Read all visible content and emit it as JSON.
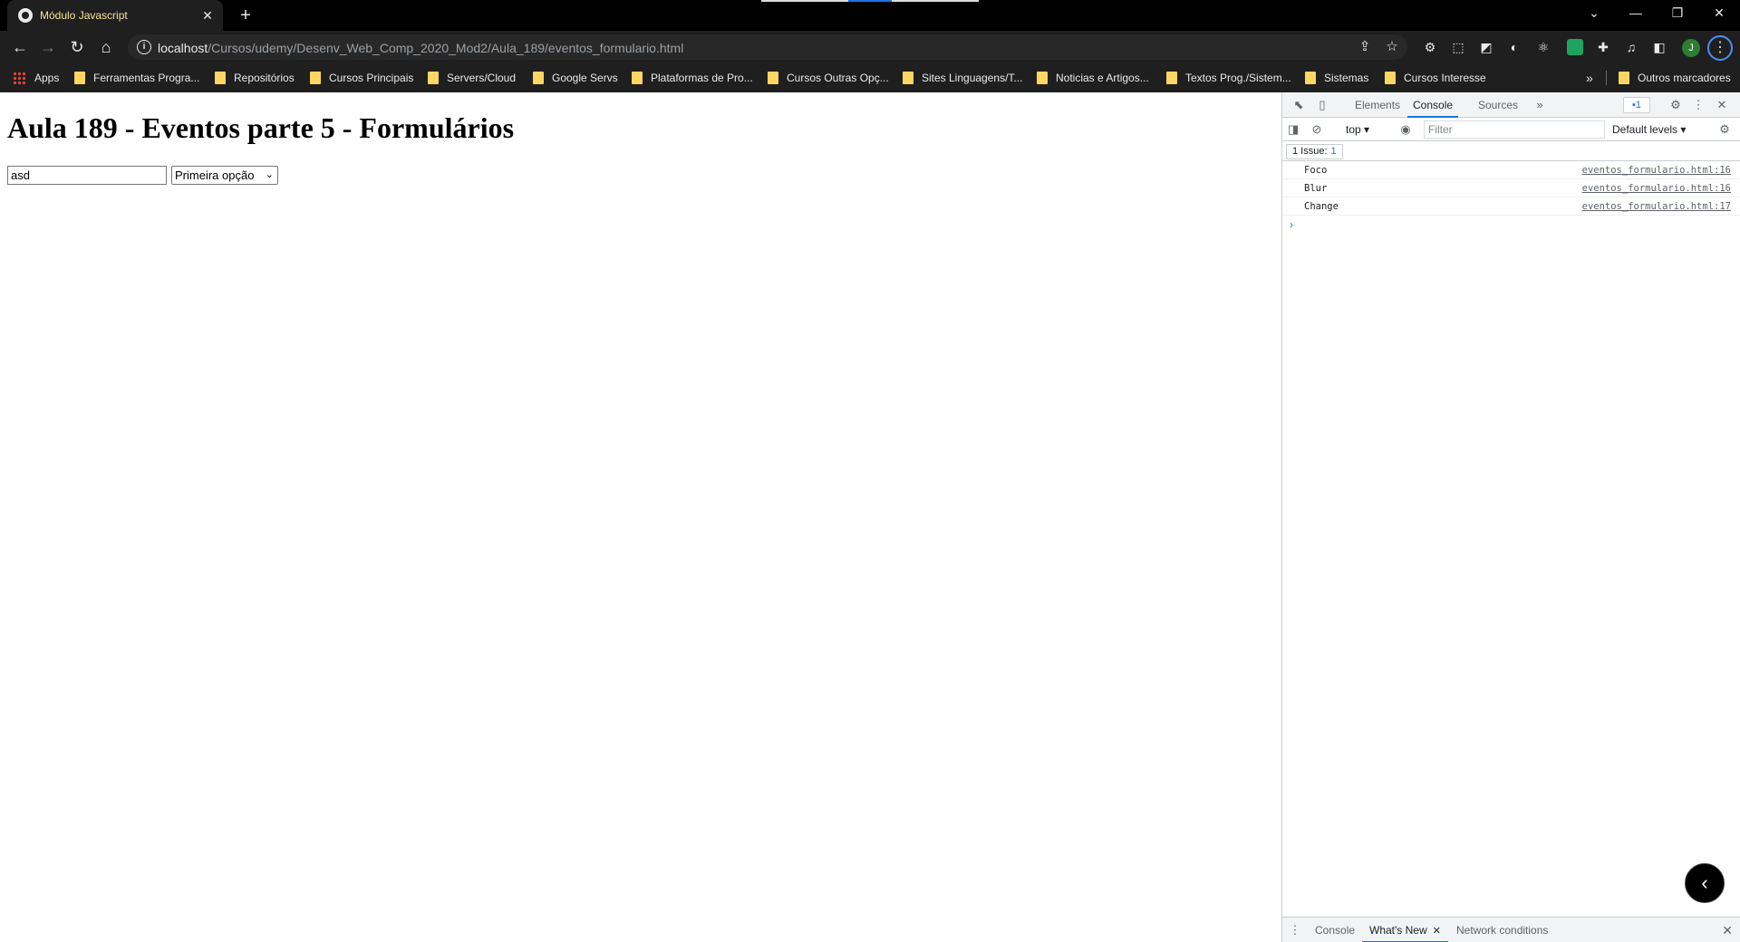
{
  "browser": {
    "tab_title": "Módulo Javascript",
    "tab_close": "✕",
    "new_tab": "+",
    "window_controls": [
      "⌄",
      "—",
      "❐",
      "✕"
    ],
    "url_host": "localhost",
    "url_path": "/Cursos/udemy/Desenv_Web_Comp_2020_Mod2/Aula_189/eventos_formulario.html",
    "profile_initial": "J"
  },
  "bookmarks": {
    "apps_label": "Apps",
    "items": [
      "Ferramentas Progra...",
      "Repositórios",
      "Cursos Principais",
      "Servers/Cloud",
      "Google Servs",
      "Plataformas de Pro...",
      "Cursos Outras Opç...",
      "Sites Linguagens/T...",
      "Noticias e Artigos...",
      "Textos Prog./Sistem...",
      "Sistemas",
      "Cursos Interesse"
    ],
    "more": "»",
    "other": "Outros marcadores"
  },
  "page": {
    "heading": "Aula 189 - Eventos parte 5 - Formulários",
    "input_value": "asd",
    "select_value": "Primeira opção"
  },
  "devtools": {
    "tabs": [
      "Elements",
      "Console",
      "Sources"
    ],
    "active_tab": "Console",
    "issues_badge": "1",
    "context": "top",
    "filter_placeholder": "Filter",
    "levels": "Default levels",
    "issues_text": "1 Issue:",
    "issues_count": "1",
    "logs": [
      {
        "msg": "Foco",
        "src": "eventos_formulario.html:16"
      },
      {
        "msg": "Blur",
        "src": "eventos_formulario.html:16"
      },
      {
        "msg": "Change",
        "src": "eventos_formulario.html:17"
      }
    ],
    "prompt": "›",
    "drawer_tabs": [
      "Console",
      "What's New",
      "Network conditions"
    ]
  },
  "colors": {
    "accent": "#1a73e8",
    "tab_title": "#fde293",
    "folder": "#fdd663"
  }
}
